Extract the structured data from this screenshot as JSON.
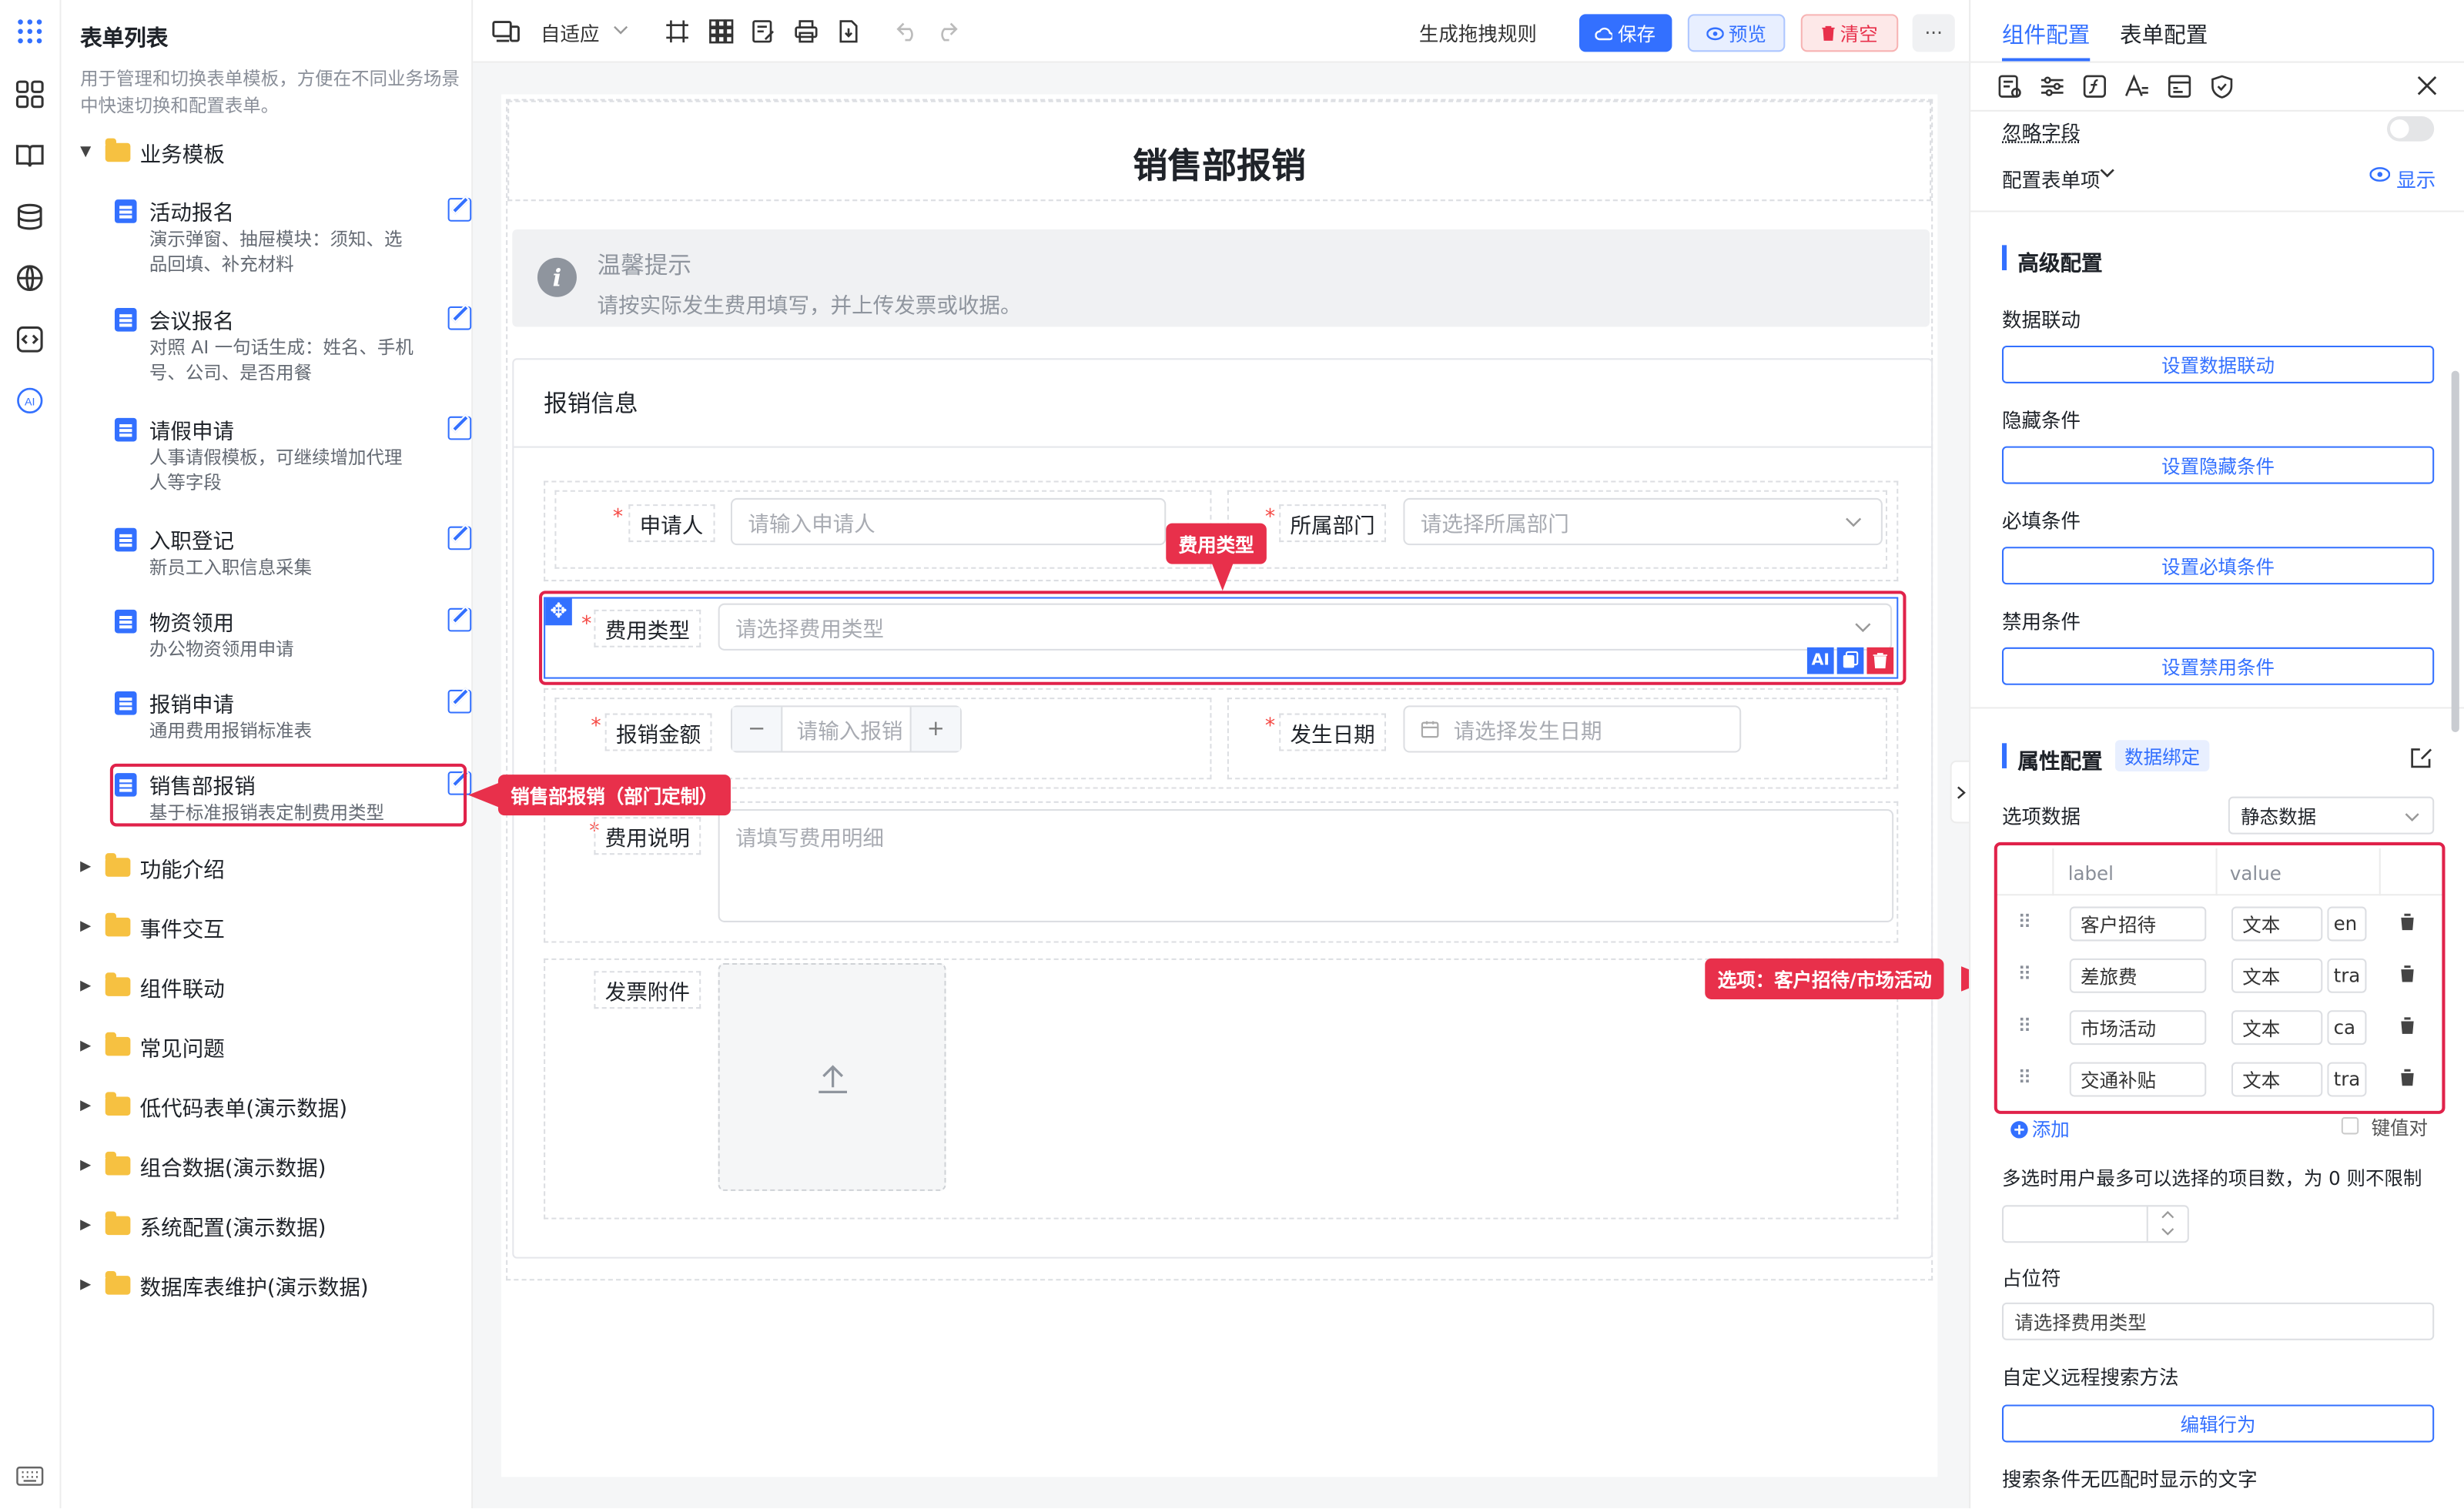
{
  "rail": {
    "icons": [
      "apps-icon",
      "grid-icon",
      "book-icon",
      "database-icon",
      "globe-icon",
      "code-icon",
      "ai-icon",
      "keyboard-icon"
    ],
    "ai_label": "AI"
  },
  "tree": {
    "title": "表单列表",
    "description": "用于管理和切换表单模板，方便在不同业务场景中快速切换和配置表单。",
    "root_folder": "业务模板",
    "items": [
      {
        "name": "活动报名",
        "desc": "演示弹窗、抽屉模块：须知、选品回填、补充材料"
      },
      {
        "name": "会议报名",
        "desc": "对照 AI 一句话生成：姓名、手机号、公司、是否用餐"
      },
      {
        "name": "请假申请",
        "desc": "人事请假模板，可继续增加代理人等字段"
      },
      {
        "name": "入职登记",
        "desc": "新员工入职信息采集"
      },
      {
        "name": "物资领用",
        "desc": "办公物资领用申请"
      },
      {
        "name": "报销申请",
        "desc": "通用费用报销标准表"
      },
      {
        "name": "销售部报销",
        "desc": "基于标准报销表定制费用类型"
      }
    ],
    "folders": [
      "功能介绍",
      "事件交互",
      "组件联动",
      "常见问题",
      "低代码表单(演示数据)",
      "组合数据(演示数据)",
      "系统配置(演示数据)",
      "数据库表维护(演示数据)"
    ]
  },
  "toolbar": {
    "mode": "自适应",
    "rule": "生成拖拽规则",
    "save": "保存",
    "preview": "预览",
    "clear": "清空",
    "more": "···"
  },
  "form": {
    "title": "销售部报销",
    "tip_title": "温馨提示",
    "tip_text": "请按实际发生费用填写，并上传发票或收据。",
    "section": "报销信息",
    "applicant_label": "申请人",
    "applicant_ph": "请输入申请人",
    "dept_label": "所属部门",
    "dept_ph": "请选择所属部门",
    "type_label": "费用类型",
    "type_ph": "请选择费用类型",
    "amount_label": "报销金额",
    "amount_ph": "请输入报销",
    "minus": "−",
    "plus": "+",
    "date_label": "发生日期",
    "date_ph": "请选择发生日期",
    "desc_label": "费用说明",
    "desc_ph": "请填写费用明细",
    "attach_label": "发票附件",
    "ai_tag": "AI",
    "req": "*"
  },
  "callouts": {
    "type": "费用类型",
    "sales": "销售部报销（部门定制）",
    "options": "选项：客户招待/市场活动"
  },
  "right": {
    "tab_component": "组件配置",
    "tab_form": "表单配置",
    "ignore": "忽略字段",
    "config_item": "配置表单项",
    "show": "显示",
    "advanced": "高级配置",
    "data_link": "数据联动",
    "data_link_btn": "设置数据联动",
    "hide_cond": "隐藏条件",
    "hide_btn": "设置隐藏条件",
    "req_cond": "必填条件",
    "req_btn": "设置必填条件",
    "dis_cond": "禁用条件",
    "dis_btn": "设置禁用条件",
    "attr": "属性配置",
    "binding": "数据绑定",
    "options_label": "选项数据",
    "options_mode": "静态数据",
    "col_label": "label",
    "col_value": "value",
    "rows": [
      {
        "label": "客户招待",
        "type": "文本",
        "value": "en"
      },
      {
        "label": "差旅费",
        "type": "文本",
        "value": "tra"
      },
      {
        "label": "市场活动",
        "type": "文本",
        "value": "ca"
      },
      {
        "label": "交通补贴",
        "type": "文本",
        "value": "tra"
      }
    ],
    "add": "添加",
    "kv": "键值对",
    "multi_hint": "多选时用户最多可以选择的项目数，为 0 则不限制",
    "placeholder_label": "占位符",
    "placeholder_val": "请选择费用类型",
    "remote": "自定义远程搜索方法",
    "edit_btn": "编辑行为",
    "nomatch": "搜索条件无匹配时显示的文字"
  },
  "colors": {
    "primary": "#3370ff",
    "danger": "#e8304b",
    "folder": "#f6c141"
  }
}
